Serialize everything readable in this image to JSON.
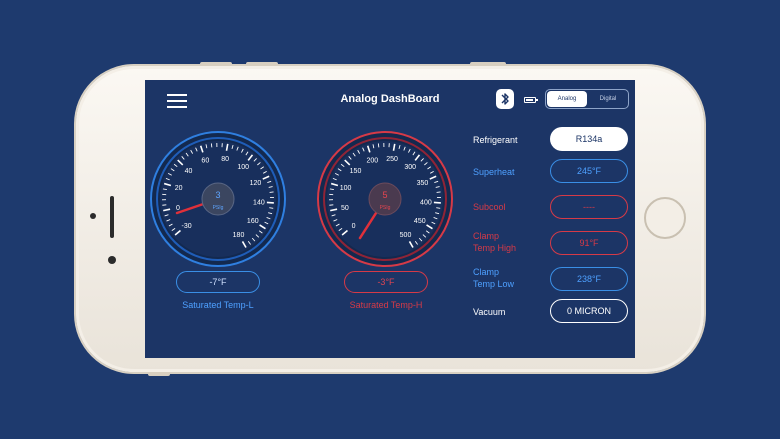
{
  "header": {
    "title": "Analog DashBoard",
    "toggle": {
      "analog": "Analog",
      "digital": "Digital",
      "selected": "Analog"
    }
  },
  "gauge_low": {
    "center_value": "3",
    "unit": "PSIg",
    "ticks": [
      "-30",
      "0",
      "20",
      "40",
      "60",
      "80",
      "100",
      "120",
      "140",
      "160",
      "180"
    ],
    "readout": "-7°F",
    "caption": "Saturated Temp-L",
    "color": "#3a8fe6"
  },
  "gauge_high": {
    "center_value": "5",
    "unit": "PSIg",
    "ticks": [
      "0",
      "50",
      "100",
      "150",
      "200",
      "250",
      "300",
      "350",
      "400",
      "450",
      "500"
    ],
    "readout": "-3°F",
    "caption": "Saturated Temp-H",
    "color": "#d63a47"
  },
  "readings": [
    {
      "label": "Refrigerant",
      "value": "R134a",
      "style": "white-filled"
    },
    {
      "label": "Superheat",
      "value": "245°F",
      "style": "blue"
    },
    {
      "label": "Subcool",
      "value": "----",
      "style": "red"
    },
    {
      "label": "Clamp\nTemp High",
      "value": "91°F",
      "style": "red"
    },
    {
      "label": "Clamp\nTemp Low",
      "value": "238°F",
      "style": "blue"
    },
    {
      "label": "Vacuum",
      "value": "0 MICRON",
      "style": "white-outline"
    }
  ],
  "icons": [
    "menu-icon",
    "bluetooth-icon",
    "battery-icon"
  ]
}
